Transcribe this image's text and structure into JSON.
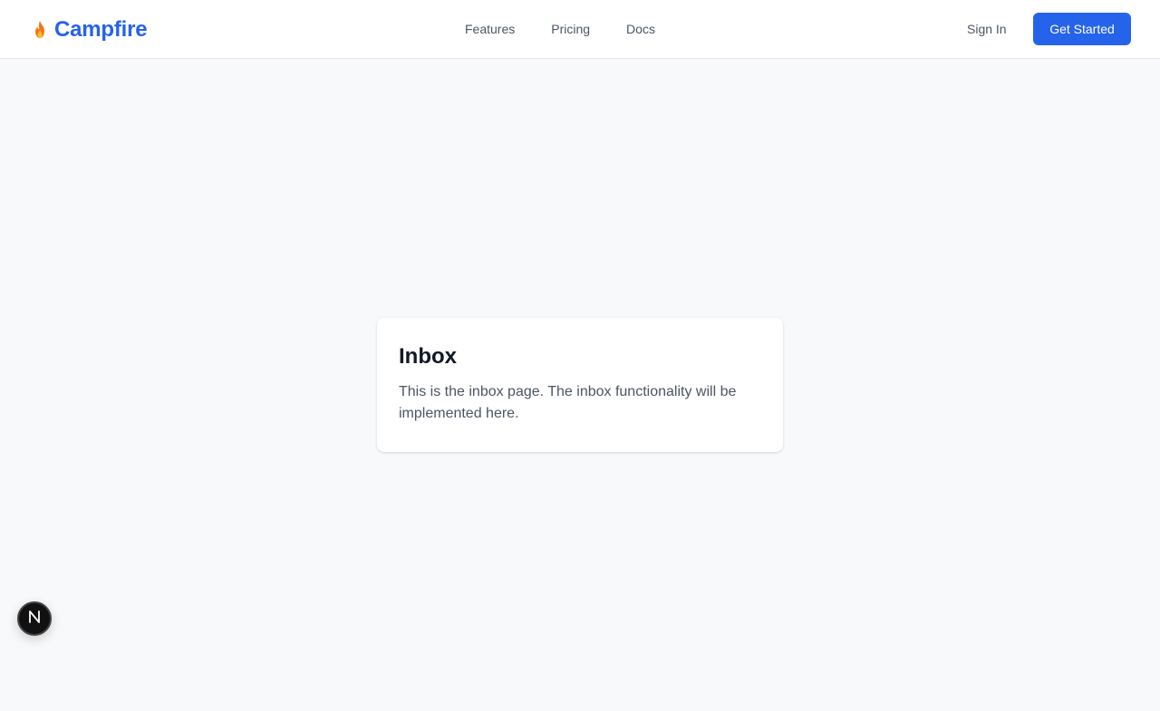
{
  "header": {
    "brand": {
      "icon": "flame-icon",
      "name": "Campfire"
    },
    "nav": [
      {
        "label": "Features"
      },
      {
        "label": "Pricing"
      },
      {
        "label": "Docs"
      }
    ],
    "sign_in_label": "Sign In",
    "cta_label": "Get Started"
  },
  "main": {
    "card": {
      "title": "Inbox",
      "body": "This is the inbox page. The inbox functionality will be implemented here."
    }
  },
  "dev_indicator": {
    "icon": "nextjs-icon"
  },
  "colors": {
    "accent": "#2563eb",
    "background": "#f8f9fb",
    "text_primary": "#111827",
    "text_secondary": "#4b5563"
  }
}
